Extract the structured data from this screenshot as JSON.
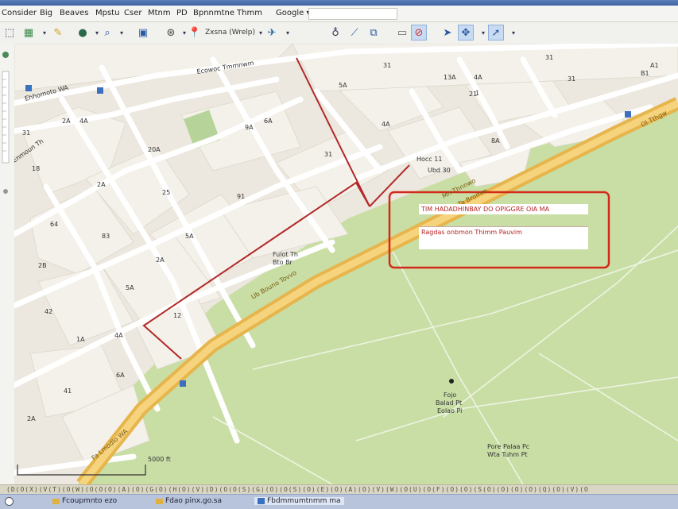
{
  "menu": {
    "items": [
      "Consider",
      "Big",
      "Beaves",
      "Mpstu",
      "Cser",
      "Mtnm",
      "PD",
      "Bpnnmtne",
      "Thmm",
      "Google"
    ]
  },
  "toolbar": {
    "label_place": "Zxsna (Wrelp)"
  },
  "map": {
    "streets": {
      "top": "Ecowoc Tmmnwm",
      "left": "Ehhomoto WA",
      "left2": "Enmoun Th",
      "highway_right": "Ol Tthgw",
      "highway_mid": "Mn Thnnwo",
      "highway_mid2": "Ta Bromm",
      "highway_low": "Ub Bouno Tovvo",
      "highway_low2": "Fa Lmodlo WA"
    },
    "block_labels": [
      "31",
      "2A",
      "4A",
      "18",
      "25",
      "20A",
      "2A",
      "64",
      "83",
      "5A",
      "91",
      "2A",
      "2B",
      "5A",
      "42",
      "1A",
      "4A",
      "6A",
      "41",
      "2A",
      "12",
      "9A",
      "6A",
      "5A",
      "31",
      "4A",
      "13A",
      "4A",
      "8A",
      "31",
      "31",
      "21",
      "31",
      "1",
      "B1",
      "A1"
    ],
    "poi_labels": [
      "Hocc 11",
      "Ubd 30",
      "Fulot Th",
      "Bto Br"
    ],
    "park_labels": [
      "Fojo",
      "Balad Pt",
      "Eolao Pi",
      "Pore Palaa Pc",
      "Wta Tuhm Pt"
    ],
    "scale_label": "5000 ft",
    "popup": {
      "row1": "TIM HADADHINBAY DO OPIGGRE OIA MA",
      "row2": "Ragdas onbmon Thimm Pauvim"
    }
  },
  "statusbar": {
    "coords_text": "(D(O(X)(V(T)(O(W)(O(O(O)(A)(O)(G(O)(H(O)(V)(D)(O(O(S)(G)(O)(O(S)(O)(E)(O)(A)(O)(V)(W)(O(U)(O(F)(O)(O)(S(O)(O)(O)(O)(Q)(O)(V)(O",
    "item1": "Fcoupmnto ezo",
    "item2": "Fdao pinx.go.sa",
    "item3": "Fbdmmumtnmm ma"
  }
}
